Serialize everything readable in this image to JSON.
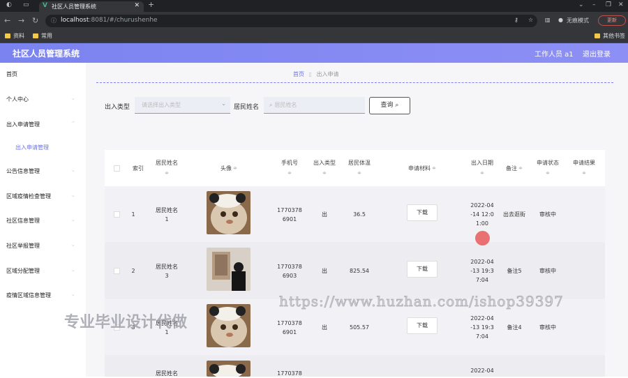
{
  "browser": {
    "tab_title": "社区人员管理系统",
    "url_host": "localhost",
    "url_path": ":8081/#/churushenhe",
    "incognito_label": "无痕模式",
    "update_label": "更新",
    "bookmarks": [
      "资料",
      "常用"
    ],
    "other_bookmarks": "其他书签"
  },
  "header": {
    "title": "社区人员管理系统",
    "user": "工作人员 a1",
    "logout": "退出登录",
    "accent": "#7b83f0"
  },
  "sidebar": {
    "items": [
      "首页",
      "个人中心",
      "出入申请管理",
      "出入申请管理",
      "公告信息管理",
      "区域疫情检查管理",
      "社区信息管理",
      "社区举报管理",
      "区域分配管理",
      "疫情区域信息管理"
    ]
  },
  "breadcrumb": {
    "home": "首页",
    "current": "出入申请"
  },
  "search": {
    "type_label": "出入类型",
    "type_placeholder": "请选择出入类型",
    "name_label": "居民姓名",
    "name_placeholder": "居民姓名",
    "query_button": "查询"
  },
  "table": {
    "headers": [
      "索引",
      "居民姓名",
      "头像",
      "手机号",
      "出入类型",
      "居民体温",
      "申请材料",
      "出入日期",
      "备注",
      "申请状态",
      "申请结果"
    ],
    "rows": [
      {
        "index": "1",
        "name": "居民姓名\n1",
        "phone": "1770378\n6901",
        "type": "出",
        "temp": "36.5",
        "file": "下载",
        "date": "2022-04\n-14 12:0\n1:00",
        "note": "出去逛街",
        "status": "审核中",
        "result": ""
      },
      {
        "index": "2",
        "name": "居民姓名\n3",
        "phone": "1770378\n6903",
        "type": "出",
        "temp": "825.54",
        "file": "下载",
        "date": "2022-04\n-13 19:3\n7:04",
        "note": "备注5",
        "status": "审核中",
        "result": ""
      },
      {
        "index": "3",
        "name": "居民姓名\n1",
        "phone": "1770378\n6901",
        "type": "出",
        "temp": "505.57",
        "file": "下载",
        "date": "2022-04\n-13 19:3\n7:04",
        "note": "备注4",
        "status": "审核中",
        "result": ""
      },
      {
        "index": "",
        "name": "居民姓名",
        "phone": "1770378",
        "type": "",
        "temp": "",
        "file": "",
        "date": "2022-04",
        "note": "",
        "status": "",
        "result": ""
      }
    ]
  },
  "watermarks": {
    "url": "https://www.huzhan.com/ishop39397",
    "text": "专业毕业设计代做"
  }
}
